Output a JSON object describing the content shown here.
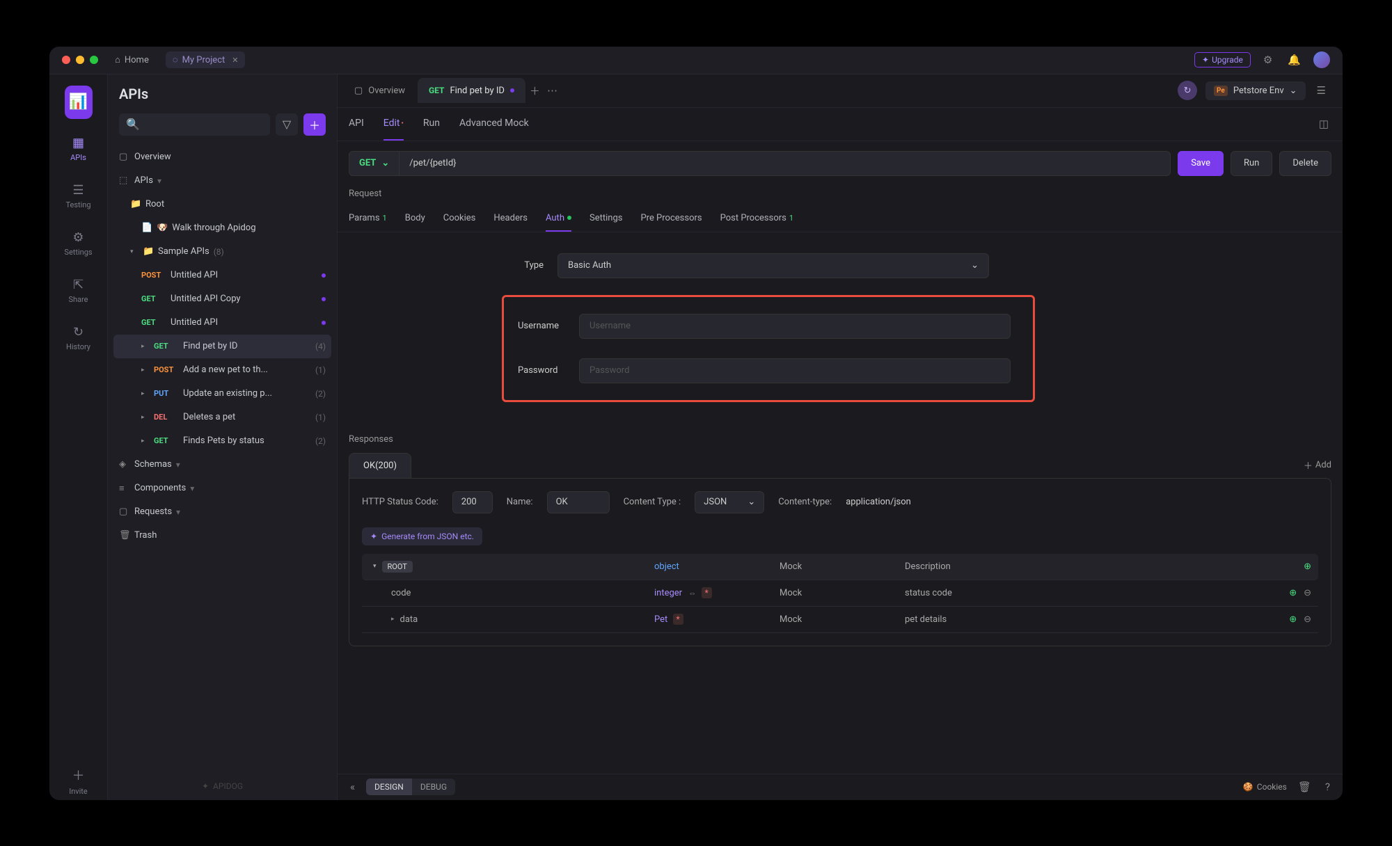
{
  "titlebar": {
    "home": "Home",
    "project": "My Project",
    "upgrade": "Upgrade"
  },
  "rail": {
    "items": [
      {
        "label": "APIs",
        "icon": "🗂"
      },
      {
        "label": "Testing",
        "icon": "≡"
      },
      {
        "label": "Settings",
        "icon": "⚙"
      },
      {
        "label": "Share",
        "icon": "↗"
      },
      {
        "label": "History",
        "icon": "🕒"
      }
    ],
    "invite": "Invite"
  },
  "sidebar": {
    "title": "APIs",
    "overview": "Overview",
    "apis_label": "APIs",
    "root": "Root",
    "walk": "Walk through Apidog",
    "sample_group": "Sample APIs",
    "sample_count": "(8)",
    "items": [
      {
        "method": "POST",
        "label": "Untitled API",
        "dot": true
      },
      {
        "method": "GET",
        "label": "Untitled API Copy",
        "dot": true
      },
      {
        "method": "GET",
        "label": "Untitled API",
        "dot": true
      },
      {
        "method": "GET",
        "label": "Find pet by ID",
        "count": "(4)",
        "selected": true
      },
      {
        "method": "POST",
        "label": "Add a new pet to th...",
        "count": "(1)"
      },
      {
        "method": "PUT",
        "label": "Update an existing p...",
        "count": "(2)"
      },
      {
        "method": "DEL",
        "label": "Deletes a pet",
        "count": "(1)"
      },
      {
        "method": "GET",
        "label": "Finds Pets by status",
        "count": "(2)"
      }
    ],
    "schemas": "Schemas",
    "components": "Components",
    "requests": "Requests",
    "trash": "Trash",
    "brand": "APIDOG"
  },
  "tabs": {
    "overview": "Overview",
    "current_method": "GET",
    "current_label": "Find pet by ID",
    "env": "Petstore Env",
    "env_badge": "Pe"
  },
  "subtabs": [
    "API",
    "Edit",
    "Run",
    "Advanced Mock"
  ],
  "url": {
    "method": "GET",
    "path": "/pet/{petId}",
    "save": "Save",
    "run": "Run",
    "delete": "Delete"
  },
  "request": {
    "label": "Request",
    "tabs": {
      "params": "Params",
      "params_badge": "1",
      "body": "Body",
      "cookies": "Cookies",
      "headers": "Headers",
      "auth": "Auth",
      "settings": "Settings",
      "pre": "Pre Processors",
      "post": "Post Processors",
      "post_badge": "1"
    }
  },
  "auth": {
    "type_label": "Type",
    "type_value": "Basic Auth",
    "username_label": "Username",
    "username_placeholder": "Username",
    "password_label": "Password",
    "password_placeholder": "Password"
  },
  "responses": {
    "label": "Responses",
    "add": "Add",
    "tab": "OK(200)",
    "status_label": "HTTP Status Code:",
    "status_value": "200",
    "name_label": "Name:",
    "name_value": "OK",
    "ct_label": "Content Type :",
    "ct_value": "JSON",
    "ct2_label": "Content-type:",
    "ct2_value": "application/json",
    "gen": "Generate from JSON etc.",
    "cols": {
      "mock": "Mock",
      "desc": "Description"
    },
    "rows": [
      {
        "name": "ROOT",
        "type": "object",
        "mock": "Mock",
        "desc": "Description",
        "root": true
      },
      {
        "name": "code",
        "type": "integer",
        "mock": "Mock",
        "desc": "status code",
        "req": true,
        "link": true
      },
      {
        "name": "data",
        "type": "Pet",
        "mock": "Mock",
        "desc": "pet details",
        "req": true
      }
    ]
  },
  "bottom": {
    "design": "DESIGN",
    "debug": "DEBUG",
    "cookies": "Cookies"
  }
}
